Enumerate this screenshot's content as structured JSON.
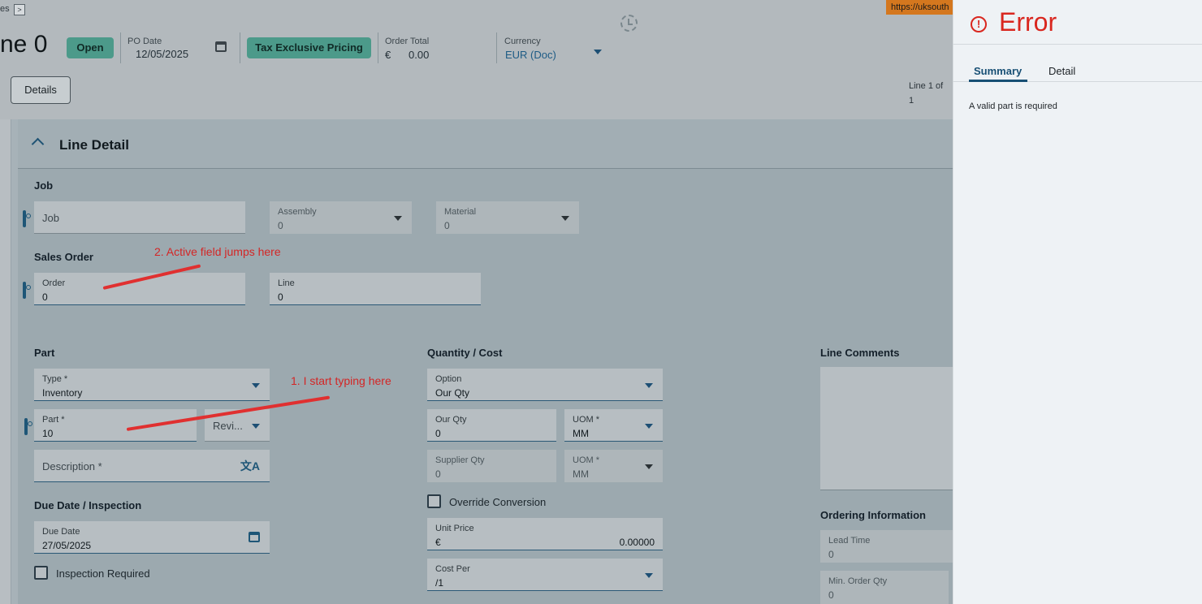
{
  "header": {
    "breadcrumb_tail": "es",
    "crumb_button": ">",
    "title": "ne 0",
    "status_pill": "Open",
    "po_date_label": "PO Date",
    "po_date_value": "12/05/2025",
    "pricing_pill": "Tax Exclusive Pricing",
    "order_total_label": "Order Total",
    "currency_symbol": "€",
    "order_total_value": "0.00",
    "currency_label": "Currency",
    "currency_value": "EUR (Doc)",
    "details_button": "Details",
    "line_of_label": "Line 1 of",
    "line_of_value": "1",
    "url_chip": "https://uksouth"
  },
  "line_detail": {
    "title": "Line Detail",
    "job_section": "Job",
    "job_placeholder": "Job",
    "assembly_label": "Assembly",
    "assembly_value": "0",
    "material_label": "Material",
    "material_value": "0",
    "sales_order_section": "Sales Order",
    "order_label": "Order",
    "order_value": "0",
    "line_label": "Line",
    "line_value": "0",
    "part_section": "Part",
    "type_label": "Type *",
    "type_value": "Inventory",
    "part_label": "Part *",
    "part_value": "10",
    "revision_placeholder": "Revi...",
    "description_placeholder": "Description *",
    "due_section": "Due Date / Inspection",
    "due_date_label": "Due Date",
    "due_date_value": "27/05/2025",
    "inspection_label": "Inspection Required",
    "qty_section": "Quantity / Cost",
    "option_label": "Option",
    "option_value": "Our Qty",
    "our_qty_label": "Our Qty",
    "our_qty_value": "0",
    "uom_label": "UOM *",
    "uom_value": "MM",
    "supplier_qty_label": "Supplier Qty",
    "supplier_qty_value": "0",
    "uom2_label": "UOM *",
    "uom2_value": "MM",
    "override_label": "Override Conversion",
    "unit_price_label": "Unit Price",
    "unit_price_currency": "€",
    "unit_price_value": "0.00000",
    "cost_per_label": "Cost Per",
    "cost_per_value": "/1",
    "comments_section": "Line Comments",
    "ordering_section": "Ordering Information",
    "lead_time_label": "Lead Time",
    "lead_time_value": "0",
    "min_order_label": "Min. Order Qty",
    "min_order_value": "0"
  },
  "annotations": {
    "note_1": "1. I start typing here",
    "note_2": "2. Active field jumps here"
  },
  "error_panel": {
    "title": "Error",
    "icon": "!",
    "tab_summary": "Summary",
    "tab_detail": "Detail",
    "message": "A valid part is required"
  }
}
